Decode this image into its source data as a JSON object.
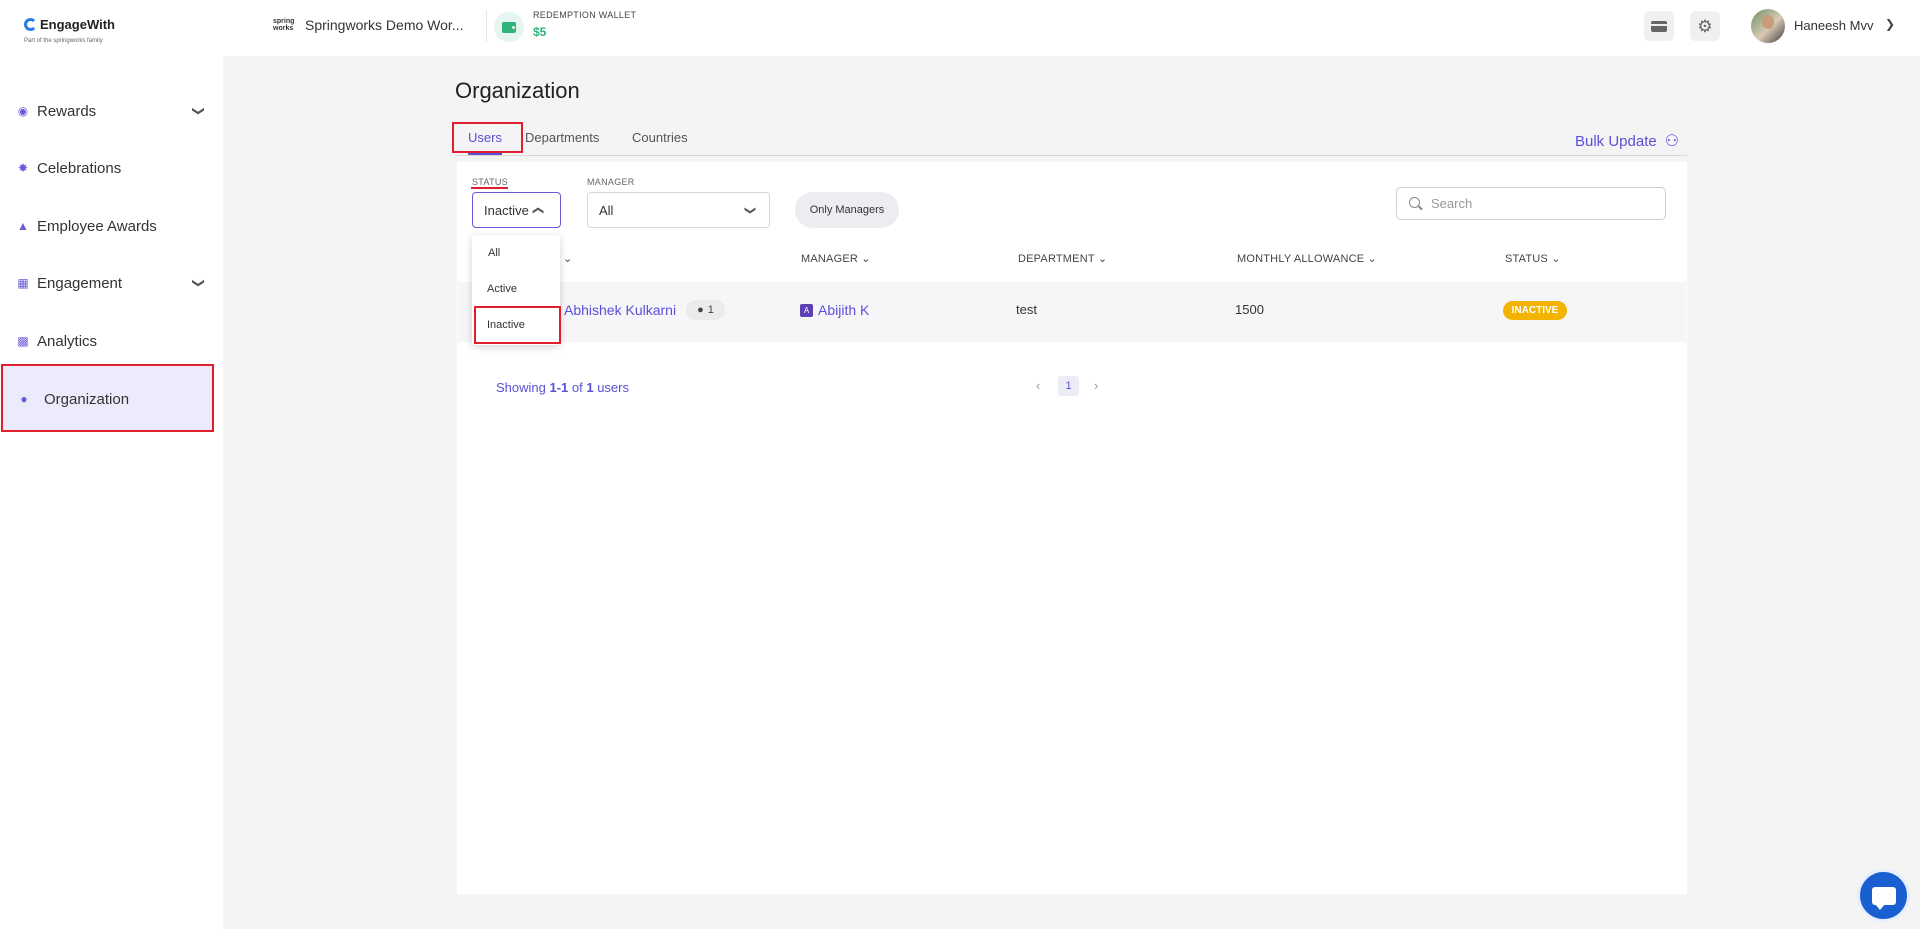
{
  "brand": {
    "name": "EngageWith",
    "tagline": "Part of the springworks family"
  },
  "workspace": {
    "logo_text": "spring works",
    "name": "Springworks Demo Wor..."
  },
  "wallet": {
    "label": "REDEMPTION WALLET",
    "value": "$5"
  },
  "user": {
    "name": "Haneesh Mvv"
  },
  "sidebar": {
    "items": [
      {
        "label": "Rewards",
        "icon": "medal-icon",
        "has_chevron": true
      },
      {
        "label": "Celebrations",
        "icon": "party-popper-icon",
        "has_chevron": false
      },
      {
        "label": "Employee Awards",
        "icon": "trophy-icon",
        "has_chevron": false
      },
      {
        "label": "Engagement",
        "icon": "engagement-icon",
        "has_chevron": true
      },
      {
        "label": "Analytics",
        "icon": "bar-chart-icon",
        "has_chevron": false
      },
      {
        "label": "Organization",
        "icon": "people-icon",
        "active": true
      }
    ]
  },
  "page": {
    "title": "Organization",
    "tabs": [
      {
        "label": "Users",
        "active": true
      },
      {
        "label": "Departments"
      },
      {
        "label": "Countries"
      }
    ],
    "bulk_update": "Bulk Update"
  },
  "filters": {
    "status_label": "STATUS",
    "status_value": "Inactive",
    "manager_label": "MANAGER",
    "manager_value": "All",
    "only_managers": "Only Managers",
    "search_placeholder": "Search",
    "status_options": [
      "All",
      "Active",
      "Inactive"
    ]
  },
  "table": {
    "headers": [
      "MANAGER",
      "DEPARTMENT",
      "MONTHLY ALLOWANCE",
      "STATUS"
    ],
    "rows": [
      {
        "name": "Abhishek Kulkarni",
        "reports": "1",
        "manager_initial": "A",
        "manager": "Abijith K",
        "department": "test",
        "allowance": "1500",
        "status": "INACTIVE"
      }
    ]
  },
  "pagination": {
    "prefix": "Showing ",
    "range": "1-1",
    "of": " of ",
    "total": "1",
    "suffix": " users",
    "current_page": "1",
    "prev_icon": "chevron-left-icon",
    "next_icon": "chevron-right-icon"
  },
  "colors": {
    "accent": "#5b4fd6",
    "inactive_badge": "#f2b400",
    "highlight_box": "#e01e2d",
    "wallet_green": "#2fb37a"
  }
}
